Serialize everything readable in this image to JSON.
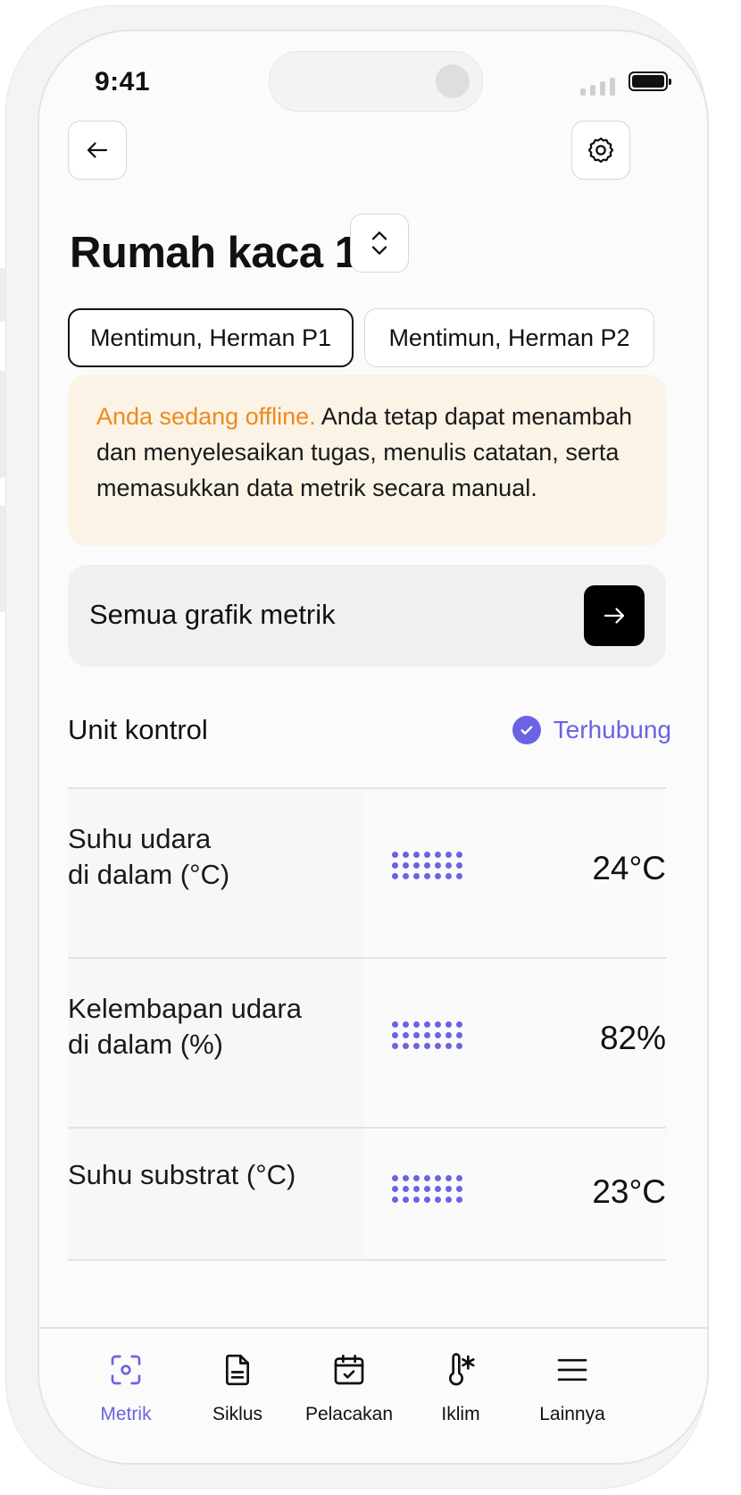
{
  "status_bar": {
    "time": "9:41"
  },
  "header": {
    "back_icon": "arrow-left-icon",
    "settings_icon": "gear-icon",
    "title": "Rumah kaca 1",
    "selector_icon": "chevron-up-down-icon"
  },
  "chips": [
    {
      "label": "Mentimun, Herman P1",
      "selected": true
    },
    {
      "label": "Mentimun, Herman P2",
      "selected": false
    }
  ],
  "offline_notice": {
    "highlight": "Anda sedang offline.",
    "text": " Anda tetap dapat menambah dan menyelesaikan tugas, menulis catatan, serta memasukkan data metrik secara manual."
  },
  "all_charts": {
    "label": "Semua grafik metrik",
    "icon": "arrow-right-icon"
  },
  "control_unit": {
    "title": "Unit kontrol",
    "status": "Terhubung",
    "status_icon": "check-circle-icon"
  },
  "metrics": [
    {
      "label": "Suhu udara\ndi dalam (°C)",
      "value": "24°C"
    },
    {
      "label": "Kelembapan udara\ndi dalam (%)",
      "value": "82%"
    },
    {
      "label": "Suhu substrat (°C)",
      "value": "23°C"
    }
  ],
  "tabs": [
    {
      "label": "Metrik",
      "icon": "scan-icon",
      "active": true
    },
    {
      "label": "Siklus",
      "icon": "document-icon",
      "active": false
    },
    {
      "label": "Pelacakan",
      "icon": "calendar-check-icon",
      "active": false
    },
    {
      "label": "Iklim",
      "icon": "thermometer-snow-icon",
      "active": false
    },
    {
      "label": "Lainnya",
      "icon": "menu-icon",
      "active": false
    }
  ],
  "colors": {
    "accent": "#6a64e4",
    "warning": "#f0891c",
    "alert_bg": "#fbf3e6"
  }
}
